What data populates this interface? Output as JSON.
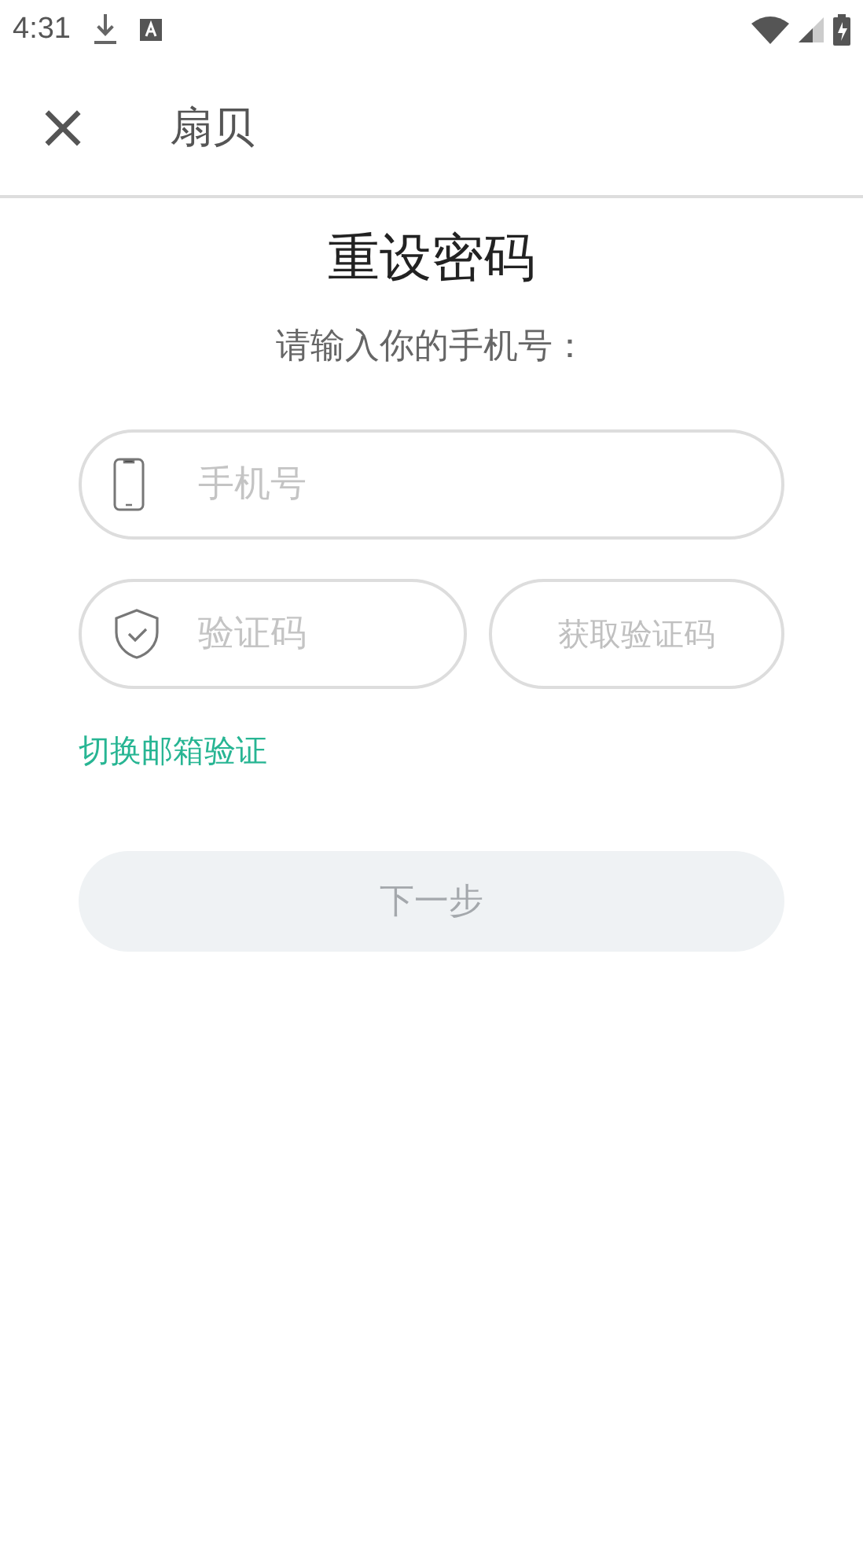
{
  "status_bar": {
    "time": "4:31"
  },
  "header": {
    "close": "×",
    "title": "扇贝"
  },
  "heading": "重设密码",
  "subtitle": "请输入你的手机号：",
  "phone_field": {
    "placeholder": "手机号"
  },
  "code_field": {
    "placeholder": "验证码"
  },
  "get_code_button": {
    "label": "获取验证码",
    "disabled": true
  },
  "switch_link": "切换邮箱验证",
  "next_button": {
    "label": "下一步",
    "disabled": true
  }
}
